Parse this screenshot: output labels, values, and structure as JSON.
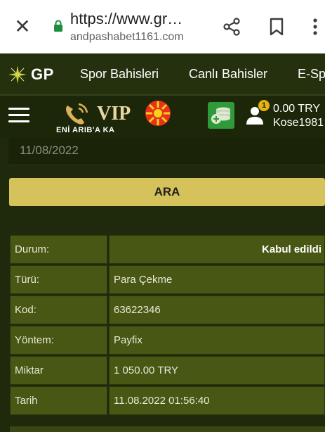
{
  "browser": {
    "url_main": "https://www.gr…",
    "url_sub": "andpashabet1161.com",
    "close_icon": "close-icon",
    "lock_icon": "lock-icon",
    "share_icon": "share-icon",
    "bookmark_icon": "bookmark-icon",
    "more_icon": "more-vert-icon"
  },
  "site": {
    "logo_text": "GP",
    "nav_items": [
      "Spor Bahisleri",
      "Canlı Bahisler",
      "E-Spor"
    ],
    "promo_vip": "VIP",
    "promo_caption": "ENİ ARIB'A KA",
    "balance": "0.00 TRY",
    "username": "Kose1981",
    "notification_count": "1"
  },
  "filters": {
    "date_value": "11/08/2022",
    "search_label": "ARA"
  },
  "details": {
    "rows": [
      {
        "label": "Durum:",
        "value": "Kabul edildi"
      },
      {
        "label": "Türü:",
        "value": "Para Çekme"
      },
      {
        "label": "Kod:",
        "value": "63622346"
      },
      {
        "label": "Yöntem:",
        "value": "Payfix"
      },
      {
        "label": "Miktar",
        "value": "1 050.00 TRY"
      },
      {
        "label": "Tarih",
        "value": "11.08.2022 01:56:40"
      }
    ]
  },
  "colors": {
    "accent": "#d6c25b",
    "header_bg": "#25300e",
    "row_bg": "#485713",
    "wallet_green": "#2f9a3a",
    "badge": "#e6b20f"
  }
}
